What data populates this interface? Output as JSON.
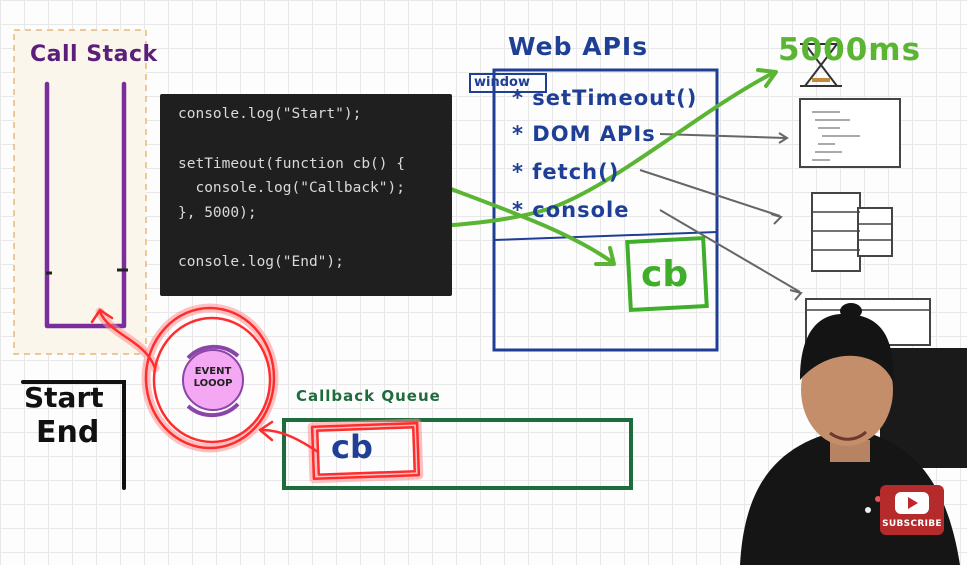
{
  "call_stack": {
    "title": "Call Stack"
  },
  "code": {
    "lines": [
      "console.log(\"Start\");",
      "",
      "setTimeout(function cb() {",
      "  console.log(\"Callback\");",
      "}, 5000);",
      "",
      "console.log(\"End\");"
    ]
  },
  "web_apis": {
    "title": "Web APIs",
    "window_label": "window",
    "items": [
      "setTimeout()",
      "DOM APIs",
      "fetch()",
      "console"
    ],
    "pending_callback": "cb"
  },
  "timer": {
    "label": "5000ms"
  },
  "console_output": {
    "title": "Start",
    "lines": [
      "End"
    ]
  },
  "event_loop": {
    "label_line1": "EVENT",
    "label_line2": "LOOOP"
  },
  "callback_queue": {
    "title": "Callback Queue",
    "item": "cb"
  },
  "overlay": {
    "subscribe_label": "SUBSCRIBE"
  },
  "colors": {
    "call_stack": "#7b2e9b",
    "web_apis": "#1e3f95",
    "arrows": "#5ab532",
    "queue": "#1e6b3c",
    "highlight": "#ff2d2d",
    "code_bg": "#1f1f1f"
  }
}
